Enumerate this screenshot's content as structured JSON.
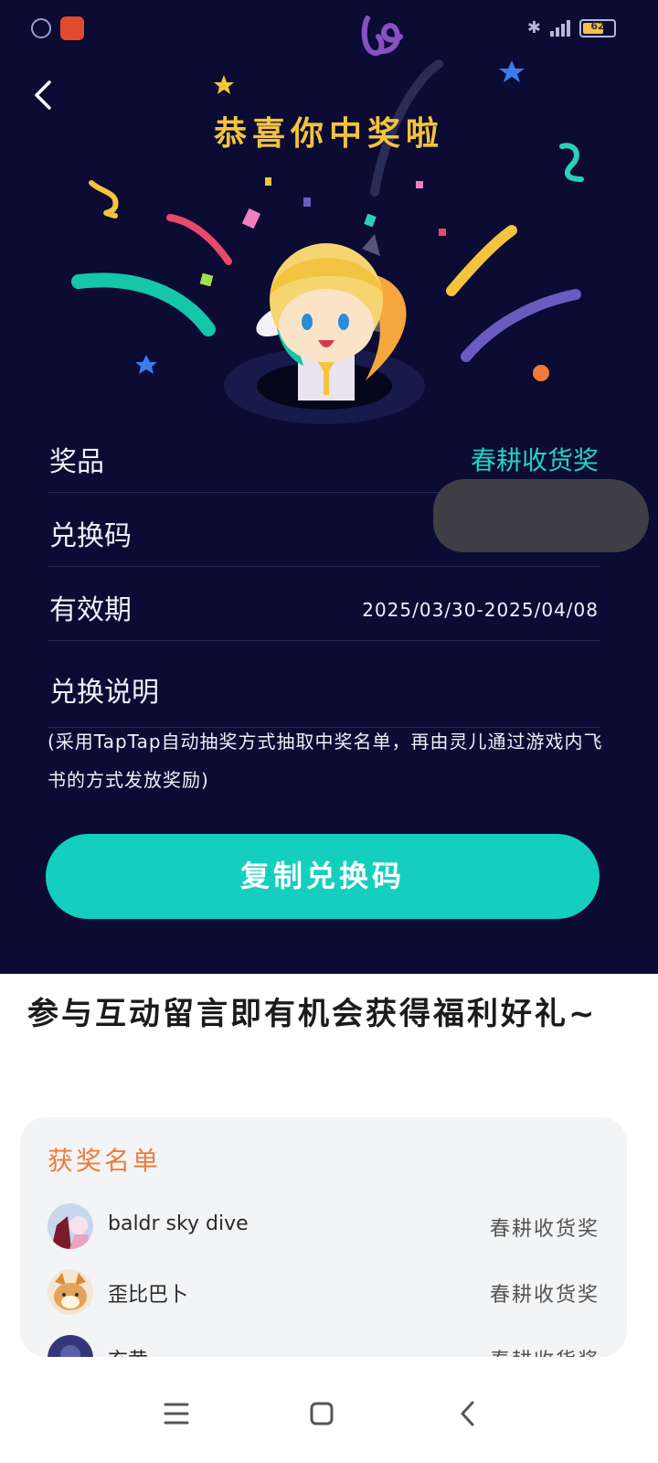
{
  "status_bar": {
    "battery_level": "62"
  },
  "prize_page": {
    "headline": "恭喜你中奖啦",
    "rows": [
      {
        "label": "奖品",
        "value": "春耕收货奖"
      },
      {
        "label": "兑换码",
        "value": ""
      },
      {
        "label": "有效期",
        "value": "2025/03/30-2025/04/08"
      }
    ],
    "instructions_title": "兑换说明",
    "instructions_text": "(采用TapTap自动抽奖方式抽取中奖名单，再由灵儿通过游戏内飞书的方式发放奖励)",
    "copy_button_label": "复制兑换码"
  },
  "promo_text": "参与互动留言即有机会获得福利好礼~",
  "winners": {
    "title": "获奖名单",
    "items": [
      {
        "name": "baldr sky dive",
        "prize": "春耕收货奖"
      },
      {
        "name": "歪比巴卜",
        "prize": "春耕收货奖"
      },
      {
        "name": "玄黄",
        "prize": "春耕收货奖"
      }
    ]
  },
  "colors": {
    "header_bg": "#0b0b33",
    "accent": "#14cfc0",
    "headline": "#f5c33d",
    "list_title": "#f07a3a"
  }
}
